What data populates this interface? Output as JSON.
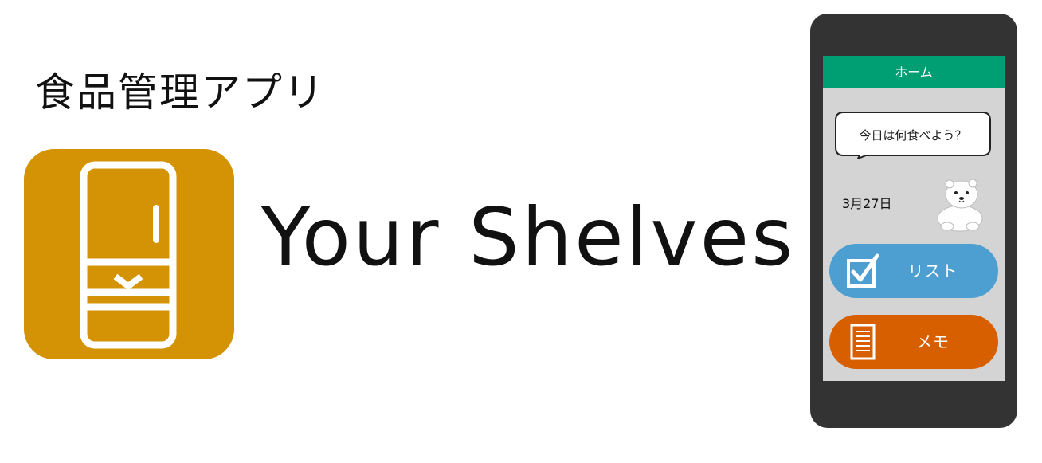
{
  "subtitle": "食品管理アプリ",
  "app_name": "Your Shelves",
  "colors": {
    "icon_background": "#d49304",
    "header": "#009e73",
    "list_button": "#4c9fd0",
    "memo_button": "#d75f00",
    "phone_body": "#333333",
    "screen_background": "#d4d4d4"
  },
  "phone": {
    "header_title": "ホーム",
    "speech_bubble": "今日は何食べよう？",
    "date": "3月27日",
    "buttons": {
      "list": {
        "label": "リスト",
        "icon": "checkbox-icon"
      },
      "memo": {
        "label": "メモ",
        "icon": "notepad-icon"
      }
    },
    "mascot": "polar-bear-icon"
  }
}
